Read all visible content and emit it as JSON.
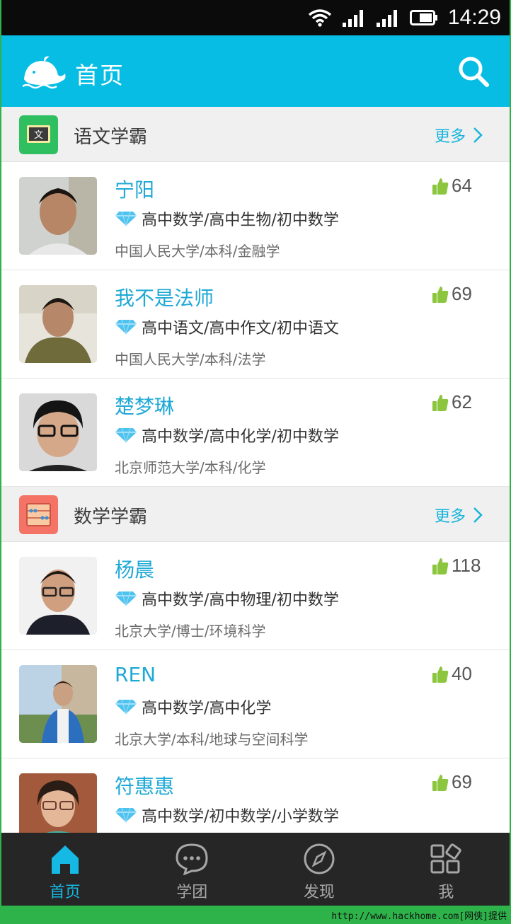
{
  "status_bar": {
    "time": "14:29"
  },
  "header": {
    "title": "首页"
  },
  "sections": [
    {
      "title": "语文学霸",
      "icon_char": "文",
      "more_label": "更多",
      "users": [
        {
          "name": "宁阳",
          "subjects": "高中数学/高中生物/初中数学",
          "school": "中国人民大学/本科/金融学",
          "likes": "64"
        },
        {
          "name": "我不是法师",
          "subjects": "高中语文/高中作文/初中语文",
          "school": "中国人民大学/本科/法学",
          "likes": "69"
        },
        {
          "name": "楚梦琳",
          "subjects": "高中数学/高中化学/初中数学",
          "school": "北京师范大学/本科/化学",
          "likes": "62"
        }
      ]
    },
    {
      "title": "数学学霸",
      "more_label": "更多",
      "users": [
        {
          "name": "杨晨",
          "subjects": "高中数学/高中物理/初中数学",
          "school": "北京大学/博士/环境科学",
          "likes": "118"
        },
        {
          "name": "REN",
          "subjects": "高中数学/高中化学",
          "school": "北京大学/本科/地球与空间科学",
          "likes": "40"
        },
        {
          "name": "符惠惠",
          "subjects": "高中数学/初中数学/小学数学",
          "school": "",
          "likes": "69"
        }
      ]
    }
  ],
  "nav": [
    {
      "label": "首页",
      "icon": "home-icon",
      "active": true
    },
    {
      "label": "学团",
      "icon": "chat-bubble-icon",
      "active": false
    },
    {
      "label": "发现",
      "icon": "compass-icon",
      "active": false
    },
    {
      "label": "我",
      "icon": "grid-icon",
      "active": false
    }
  ],
  "watermark": "http://www.hackhome.com[网侠]提供",
  "colors": {
    "header": "#08bde3",
    "name": "#1fa9d6",
    "like": "#8cc63f",
    "nav_active": "#16b8e4",
    "nav_bg": "#262626"
  }
}
